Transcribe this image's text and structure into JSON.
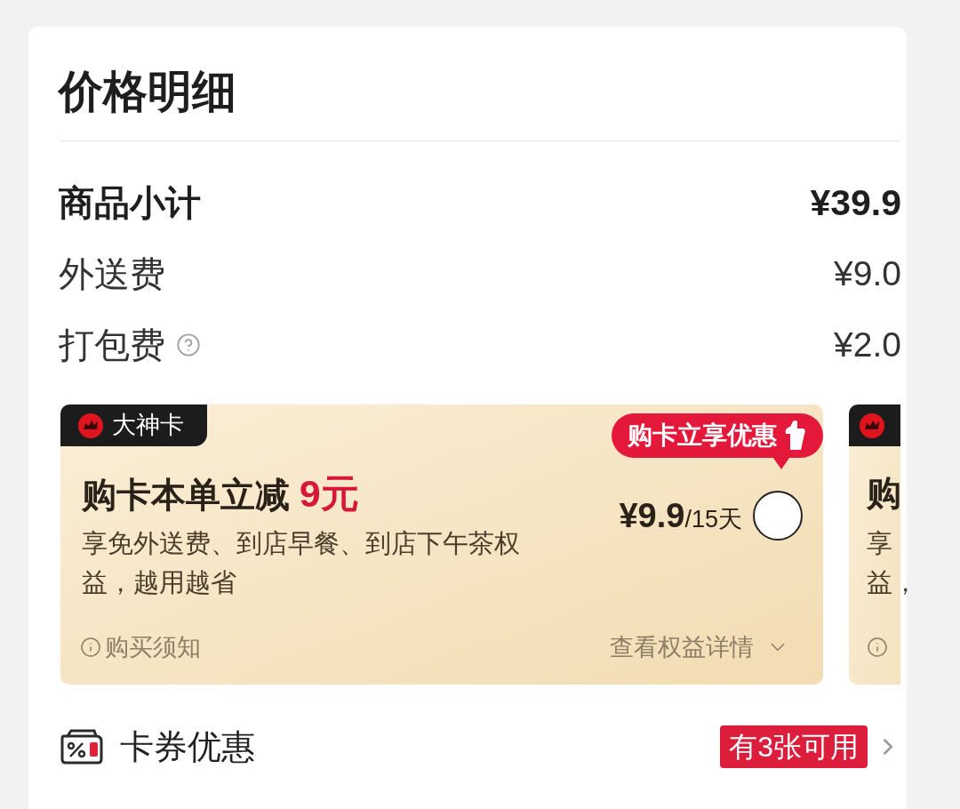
{
  "title": "价格明细",
  "rows": [
    {
      "kind": "subtotal",
      "label": "商品小计",
      "value": "¥39.9",
      "help": false
    },
    {
      "kind": "fee",
      "label": "外送费",
      "value": "¥9.0",
      "help": false
    },
    {
      "kind": "fee",
      "label": "打包费",
      "value": "¥2.0",
      "help": true
    }
  ],
  "membership_card": {
    "tag": "大神卡",
    "title": "购卡本单立减",
    "highlight": "9元",
    "description": "享免外送费、到店早餐、到店下午茶权益，越用越省",
    "promo_bubble": "购卡立享优惠",
    "price": "¥9.9",
    "period": "/15天",
    "selected": false,
    "notice": "购买须知",
    "details_link": "查看权益详情"
  },
  "next_card_peek": {
    "title": "购",
    "description_lines": [
      "享",
      "益，"
    ]
  },
  "coupons": {
    "label": "卡券优惠",
    "badge": "有3张可用"
  }
}
